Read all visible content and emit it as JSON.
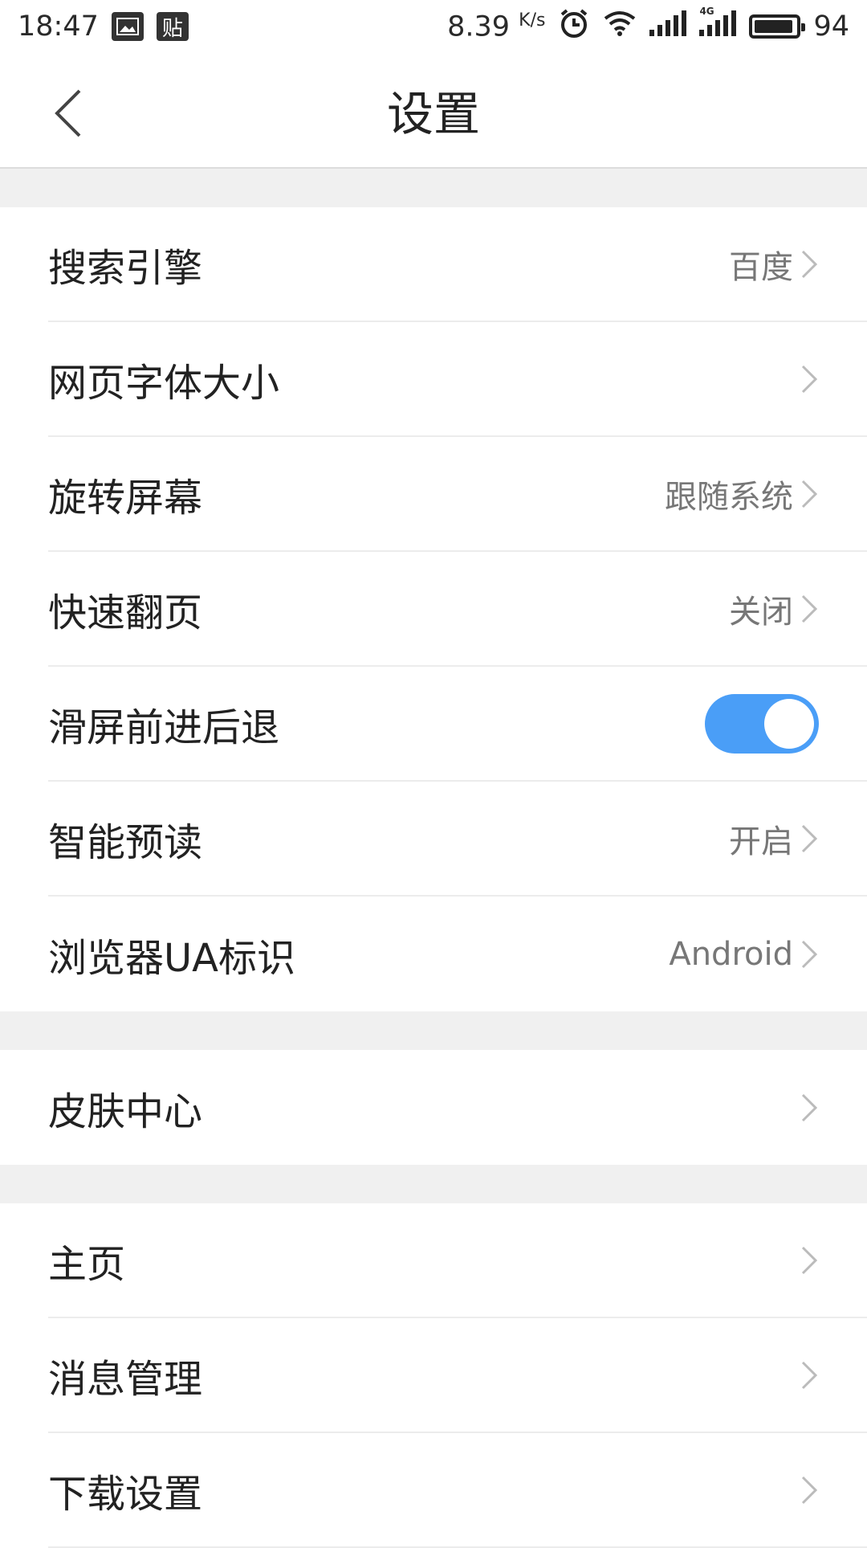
{
  "status": {
    "time": "18:47",
    "notif_icon_2_label": "贴",
    "speed": "8.39",
    "speed_unit": "K/s",
    "network": "4G",
    "battery_level": 94,
    "battery_text": "94"
  },
  "nav": {
    "title": "设置"
  },
  "sections": [
    {
      "rows": [
        {
          "label": "搜索引擎",
          "value": "百度"
        },
        {
          "label": "网页字体大小",
          "value": ""
        },
        {
          "label": "旋转屏幕",
          "value": "跟随系统"
        },
        {
          "label": "快速翻页",
          "value": "关闭"
        },
        {
          "label": "滑屏前进后退",
          "toggle": true,
          "toggle_on": true
        },
        {
          "label": "智能预读",
          "value": "开启"
        },
        {
          "label": "浏览器UA标识",
          "value": "Android"
        }
      ]
    },
    {
      "rows": [
        {
          "label": "皮肤中心",
          "value": ""
        }
      ]
    },
    {
      "rows": [
        {
          "label": "主页",
          "value": ""
        },
        {
          "label": "消息管理",
          "value": ""
        },
        {
          "label": "下载设置",
          "value": ""
        }
      ]
    }
  ],
  "colors": {
    "accent": "#4a9ef7",
    "section_gap": "#f0f0f0"
  }
}
